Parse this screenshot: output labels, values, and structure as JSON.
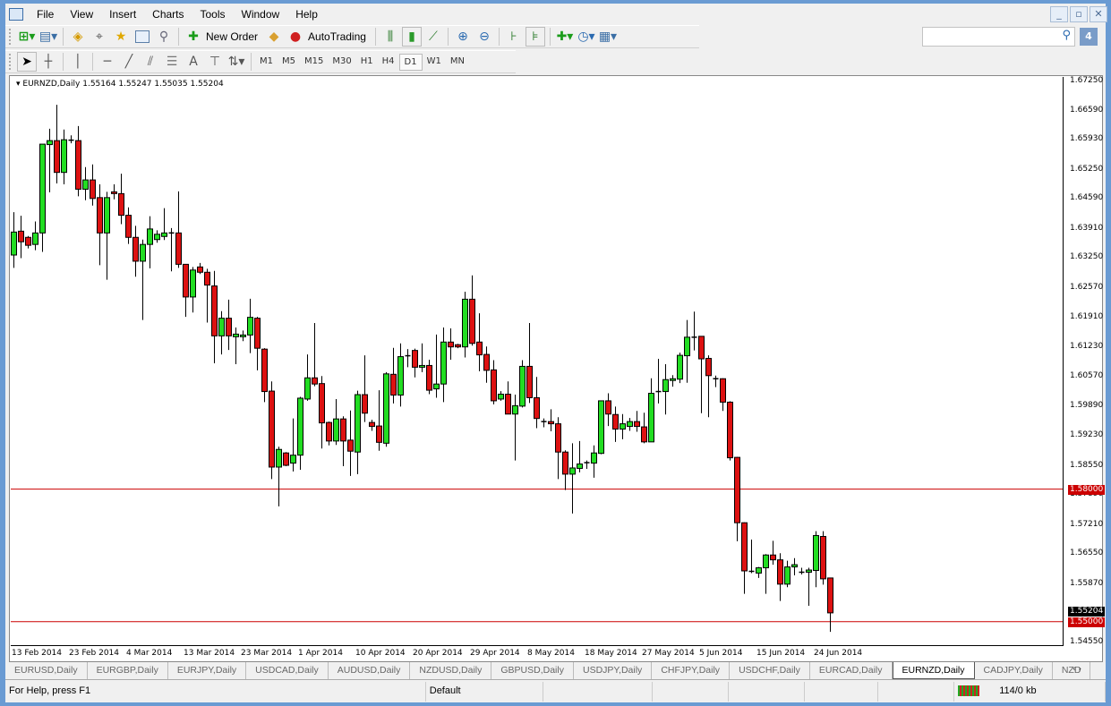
{
  "menu": [
    "File",
    "View",
    "Insert",
    "Charts",
    "Tools",
    "Window",
    "Help"
  ],
  "window_controls": {
    "minimize": "_",
    "restore": "▫",
    "close": "✕"
  },
  "toolbar": {
    "new_order": "New Order",
    "autotrading": "AutoTrading"
  },
  "timeframes": [
    "M1",
    "M5",
    "M15",
    "M30",
    "H1",
    "H4",
    "D1",
    "W1",
    "MN"
  ],
  "active_timeframe": "D1",
  "search": {
    "value": "",
    "placeholder": ""
  },
  "chart": {
    "title": "EURNZD,Daily  1.55164 1.55247 1.55035 1.55204",
    "colors": {
      "bull": "#22dd22",
      "bear": "#dd1111",
      "line": "#cc0000",
      "current": "#000000"
    }
  },
  "chart_data": {
    "type": "candlestick",
    "symbol": "EURNZD",
    "period": "Daily",
    "ylim": [
      1.5455,
      1.6725
    ],
    "y_ticks": [
      "1.67250",
      "1.66590",
      "1.65930",
      "1.65250",
      "1.64590",
      "1.63910",
      "1.63250",
      "1.62570",
      "1.61910",
      "1.61230",
      "1.60570",
      "1.59890",
      "1.59230",
      "1.58550",
      "1.57890",
      "1.57210",
      "1.56550",
      "1.55870",
      "1.54550"
    ],
    "x_ticks": [
      {
        "label": "13 Feb 2014",
        "bar": 0
      },
      {
        "label": "23 Feb 2014",
        "bar": 8
      },
      {
        "label": "4 Mar 2014",
        "bar": 16
      },
      {
        "label": "13 Mar 2014",
        "bar": 24
      },
      {
        "label": "23 Mar 2014",
        "bar": 32
      },
      {
        "label": "1 Apr 2014",
        "bar": 40
      },
      {
        "label": "10 Apr 2014",
        "bar": 48
      },
      {
        "label": "20 Apr 2014",
        "bar": 56
      },
      {
        "label": "29 Apr 2014",
        "bar": 64
      },
      {
        "label": "8 May 2014",
        "bar": 72
      },
      {
        "label": "18 May 2014",
        "bar": 80
      },
      {
        "label": "27 May 2014",
        "bar": 88
      },
      {
        "label": "5 Jun 2014",
        "bar": 96
      },
      {
        "label": "15 Jun 2014",
        "bar": 104
      },
      {
        "label": "24 Jun 2014",
        "bar": 112
      }
    ],
    "hlines": [
      {
        "price": 1.58,
        "label": "1.58000"
      },
      {
        "price": 1.55,
        "label": "1.55000"
      }
    ],
    "current_price": {
      "price": 1.55204,
      "label": "1.55204"
    },
    "ohlc": [
      [
        1.633,
        1.6427,
        1.6301,
        1.6382
      ],
      [
        1.6384,
        1.6419,
        1.6323,
        1.636
      ],
      [
        1.637,
        1.6373,
        1.6345,
        1.6352
      ],
      [
        1.6354,
        1.6406,
        1.6341,
        1.638
      ],
      [
        1.638,
        1.6581,
        1.6337,
        1.6581
      ],
      [
        1.658,
        1.6616,
        1.6472,
        1.6589
      ],
      [
        1.6589,
        1.667,
        1.6492,
        1.6517
      ],
      [
        1.6517,
        1.6614,
        1.649,
        1.6591
      ],
      [
        1.659,
        1.6601,
        1.6583,
        1.6589
      ],
      [
        1.6589,
        1.6622,
        1.6463,
        1.6479
      ],
      [
        1.6479,
        1.6529,
        1.6454,
        1.65
      ],
      [
        1.65,
        1.6535,
        1.6442,
        1.6458
      ],
      [
        1.646,
        1.649,
        1.6307,
        1.638
      ],
      [
        1.638,
        1.6473,
        1.6274,
        1.646
      ],
      [
        1.6473,
        1.649,
        1.6456,
        1.6469
      ],
      [
        1.6469,
        1.6514,
        1.64,
        1.642
      ],
      [
        1.642,
        1.6438,
        1.6355,
        1.637
      ],
      [
        1.637,
        1.6396,
        1.6281,
        1.6316
      ],
      [
        1.6316,
        1.6365,
        1.6183,
        1.6354
      ],
      [
        1.6354,
        1.6418,
        1.63,
        1.6389
      ],
      [
        1.6365,
        1.6386,
        1.6358,
        1.6377
      ],
      [
        1.6372,
        1.6436,
        1.6364,
        1.638
      ],
      [
        1.638,
        1.6391,
        1.6293,
        1.638
      ],
      [
        1.638,
        1.6474,
        1.6301,
        1.6309
      ],
      [
        1.6309,
        1.6309,
        1.619,
        1.6235
      ],
      [
        1.6235,
        1.6303,
        1.62,
        1.6296
      ],
      [
        1.6303,
        1.6312,
        1.6287,
        1.6291
      ],
      [
        1.6291,
        1.6299,
        1.6177,
        1.6262
      ],
      [
        1.626,
        1.6294,
        1.6085,
        1.6147
      ],
      [
        1.6147,
        1.6203,
        1.6105,
        1.6187
      ],
      [
        1.6187,
        1.6229,
        1.6115,
        1.6147
      ],
      [
        1.6145,
        1.6166,
        1.6083,
        1.6151
      ],
      [
        1.6145,
        1.6159,
        1.6135,
        1.6149
      ],
      [
        1.6149,
        1.6231,
        1.6108,
        1.6189
      ],
      [
        1.6187,
        1.619,
        1.6069,
        1.6119
      ],
      [
        1.6117,
        1.6119,
        1.5997,
        1.6021
      ],
      [
        1.6022,
        1.6044,
        1.5823,
        1.585
      ],
      [
        1.585,
        1.5896,
        1.5761,
        1.589
      ],
      [
        1.5882,
        1.5884,
        1.5852,
        1.5854
      ],
      [
        1.5859,
        1.596,
        1.584,
        1.5877
      ],
      [
        1.5877,
        1.6009,
        1.5844,
        1.6006
      ],
      [
        1.6004,
        1.6105,
        1.6,
        1.6052
      ],
      [
        1.6052,
        1.6176,
        1.6033,
        1.6038
      ],
      [
        1.6039,
        1.6056,
        1.5892,
        1.595
      ],
      [
        1.5951,
        1.5953,
        1.5899,
        1.5909
      ],
      [
        1.5909,
        1.6004,
        1.59,
        1.5959
      ],
      [
        1.5959,
        1.5965,
        1.5852,
        1.5909
      ],
      [
        1.5911,
        1.5978,
        1.583,
        1.5886
      ],
      [
        1.5884,
        1.6023,
        1.5834,
        1.6014
      ],
      [
        1.6014,
        1.6103,
        1.5952,
        1.5972
      ],
      [
        1.5951,
        1.5957,
        1.5932,
        1.5942
      ],
      [
        1.5943,
        1.6024,
        1.5887,
        1.5906
      ],
      [
        1.5904,
        1.6065,
        1.5896,
        1.6061
      ],
      [
        1.606,
        1.612,
        1.5994,
        1.6013
      ],
      [
        1.6013,
        1.613,
        1.5987,
        1.61
      ],
      [
        1.6102,
        1.6117,
        1.6076,
        1.6102
      ],
      [
        1.6114,
        1.6118,
        1.6053,
        1.6076
      ],
      [
        1.6076,
        1.613,
        1.6065,
        1.608
      ],
      [
        1.608,
        1.6093,
        1.6015,
        1.6024
      ],
      [
        1.6027,
        1.615,
        1.6007,
        1.6038
      ],
      [
        1.6038,
        1.6166,
        1.5997,
        1.6133
      ],
      [
        1.6133,
        1.6164,
        1.6093,
        1.6122
      ],
      [
        1.6127,
        1.6129,
        1.6119,
        1.6122
      ],
      [
        1.6122,
        1.6247,
        1.6098,
        1.623
      ],
      [
        1.623,
        1.6284,
        1.6125,
        1.613
      ],
      [
        1.6133,
        1.6198,
        1.6067,
        1.6104
      ],
      [
        1.6105,
        1.6123,
        1.6041,
        1.6069
      ],
      [
        1.607,
        1.6092,
        1.5992,
        1.6
      ],
      [
        1.6004,
        1.6022,
        1.6,
        1.6015
      ],
      [
        1.6015,
        1.6044,
        1.597,
        1.597
      ],
      [
        1.597,
        1.6014,
        1.5865,
        1.5989
      ],
      [
        1.5988,
        1.6092,
        1.5985,
        1.6078
      ],
      [
        1.6078,
        1.6176,
        1.5995,
        1.6007
      ],
      [
        1.6007,
        1.6054,
        1.5938,
        1.596
      ],
      [
        1.5953,
        1.596,
        1.594,
        1.5953
      ],
      [
        1.5953,
        1.5981,
        1.5931,
        1.5948
      ],
      [
        1.5948,
        1.5963,
        1.5823,
        1.5884
      ],
      [
        1.5884,
        1.5888,
        1.5798,
        1.5834
      ],
      [
        1.5834,
        1.5904,
        1.5745,
        1.5848
      ],
      [
        1.5847,
        1.5909,
        1.5838,
        1.5857
      ],
      [
        1.586,
        1.5865,
        1.5846,
        1.586
      ],
      [
        1.5859,
        1.5899,
        1.5826,
        1.5882
      ],
      [
        1.5881,
        1.6,
        1.5879,
        1.6
      ],
      [
        1.6,
        1.6017,
        1.5943,
        1.597
      ],
      [
        1.5969,
        1.5987,
        1.5907,
        1.5936
      ],
      [
        1.5936,
        1.597,
        1.5913,
        1.5948
      ],
      [
        1.5942,
        1.5961,
        1.5932,
        1.5953
      ],
      [
        1.5953,
        1.5977,
        1.593,
        1.5942
      ],
      [
        1.5941,
        1.5973,
        1.5904,
        1.5907
      ],
      [
        1.5907,
        1.6051,
        1.5907,
        1.6017
      ],
      [
        1.6021,
        1.6095,
        1.5994,
        1.6021
      ],
      [
        1.6021,
        1.6083,
        1.5969,
        1.6048
      ],
      [
        1.6046,
        1.6058,
        1.6032,
        1.605
      ],
      [
        1.6049,
        1.6109,
        1.604,
        1.6103
      ],
      [
        1.6102,
        1.6183,
        1.6041,
        1.6144
      ],
      [
        1.6144,
        1.6202,
        1.6114,
        1.6144
      ],
      [
        1.6146,
        1.6146,
        1.5972,
        1.6095
      ],
      [
        1.6096,
        1.6103,
        1.5963,
        1.6057
      ],
      [
        1.605,
        1.6057,
        1.6031,
        1.605
      ],
      [
        1.605,
        1.6051,
        1.5977,
        1.5997
      ],
      [
        1.5997,
        1.5999,
        1.5865,
        1.5871
      ],
      [
        1.5872,
        1.5873,
        1.5682,
        1.5724
      ],
      [
        1.5724,
        1.5725,
        1.5563,
        1.5615
      ],
      [
        1.5614,
        1.5686,
        1.561,
        1.5614
      ],
      [
        1.561,
        1.5624,
        1.5599,
        1.5622
      ],
      [
        1.5622,
        1.5653,
        1.5563,
        1.5651
      ],
      [
        1.5651,
        1.5683,
        1.5629,
        1.564
      ],
      [
        1.564,
        1.5655,
        1.5547,
        1.5585
      ],
      [
        1.5585,
        1.5638,
        1.5578,
        1.5624
      ],
      [
        1.5624,
        1.5644,
        1.5605,
        1.5629
      ],
      [
        1.5612,
        1.5622,
        1.5607,
        1.5612
      ],
      [
        1.5612,
        1.5622,
        1.5536,
        1.5617
      ],
      [
        1.5616,
        1.5705,
        1.5578,
        1.5695
      ],
      [
        1.5693,
        1.5705,
        1.5584,
        1.5597
      ],
      [
        1.5599,
        1.5599,
        1.5477,
        1.552
      ]
    ]
  },
  "tabs": [
    "EURUSD,Daily",
    "EURGBP,Daily",
    "EURJPY,Daily",
    "USDCAD,Daily",
    "AUDUSD,Daily",
    "NZDUSD,Daily",
    "GBPUSD,Daily",
    "USDJPY,Daily",
    "CHFJPY,Daily",
    "USDCHF,Daily",
    "EURCAD,Daily",
    "EURNZD,Daily",
    "CADJPY,Daily",
    "NZD"
  ],
  "active_tab": "EURNZD,Daily",
  "status": {
    "help": "For Help, press F1",
    "profile": "Default",
    "traffic": "114/0 kb"
  }
}
